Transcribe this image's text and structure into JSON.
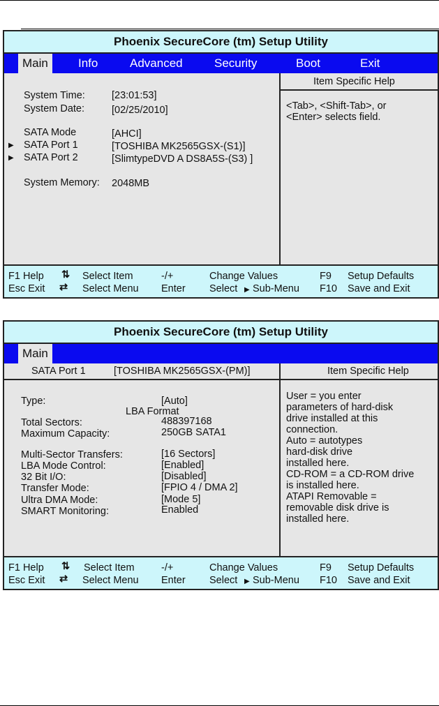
{
  "title": "Phoenix SecureCore (tm) Setup Utility",
  "screen1": {
    "menu": [
      "Main",
      "Info",
      "Advanced",
      "Security",
      "Boot",
      "Exit"
    ],
    "help_title": "Item Specific Help",
    "items": [
      {
        "label": "System Time:",
        "value": "[23:01:53]"
      },
      {
        "label": "System Date:",
        "value": "[02/25/2010]"
      },
      {
        "label": "SATA Mode",
        "value": "[AHCI]"
      },
      {
        "label": "SATA Port 1",
        "value": "[TOSHIBA MK2565GSX-(S1)]"
      },
      {
        "label": "SATA Port 2",
        "value": "[SlimtypeDVD A DS8A5S-(S3) ]"
      },
      {
        "label": "System Memory:",
        "value": "2048MB"
      }
    ],
    "help": [
      "<Tab>, <Shift-Tab>, or",
      "<Enter> selects field."
    ]
  },
  "screen2": {
    "menu": [
      "Main"
    ],
    "sub_label": "SATA Port 1",
    "sub_value": "[TOSHIBA MK2565GSX-(PM)]",
    "help_title": "Item Specific Help",
    "type_label": "Type:",
    "type_value": "[Auto]",
    "lba_format": "LBA Format",
    "items": [
      {
        "label": "Total Sectors:",
        "value": "488397168"
      },
      {
        "label": "Maximum Capacity:",
        "value": "250GB SATA1"
      },
      {
        "label": "Multi-Sector Transfers:",
        "value": "[16 Sectors]"
      },
      {
        "label": "LBA Mode Control:",
        "value": "[Enabled]"
      },
      {
        "label": "32 Bit I/O:",
        "value": "[Disabled]"
      },
      {
        "label": "Transfer Mode:",
        "value": "[FPIO 4 / DMA 2]"
      },
      {
        "label": "Ultra DMA Mode:",
        "value": "[Mode 5]"
      },
      {
        "label": "SMART Monitoring:",
        "value": "Enabled"
      }
    ],
    "help": [
      "User = you enter",
      "parameters of hard-disk",
      "drive installed at this",
      "connection.",
      "Auto = autotypes",
      "hard-disk drive",
      "installed here.",
      "CD-ROM = a CD-ROM drive",
      "is installed here.",
      "ATAPI Removable =",
      "removable disk drive is",
      "installed here."
    ]
  },
  "footer": {
    "f1": "F1 Help",
    "select_item": "Select Item",
    "minus_plus": "-/+",
    "change_values": "Change Values",
    "f9": "F9",
    "setup_defaults": "Setup Defaults",
    "esc": "Esc Exit",
    "select_menu": "Select Menu",
    "enter": "Enter",
    "select_sub": "Select",
    "sub_menu": "Sub-Menu",
    "f10": "F10",
    "save_exit": "Save and Exit"
  }
}
